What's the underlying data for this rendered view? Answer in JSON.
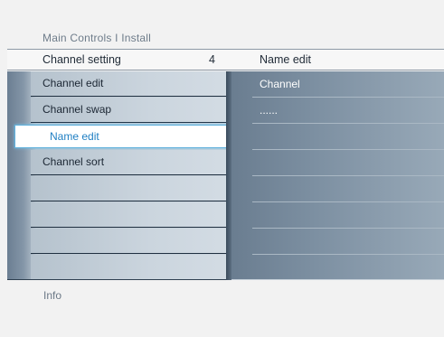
{
  "breadcrumb": "Main Controls I Install",
  "header": {
    "title": "Channel setting",
    "count": "4",
    "right_title": "Name edit"
  },
  "menu": {
    "items": [
      {
        "label": "Channel edit",
        "selected": false
      },
      {
        "label": "Channel swap",
        "selected": false
      },
      {
        "label": "Name edit",
        "selected": true
      },
      {
        "label": "Channel sort",
        "selected": false
      },
      {
        "label": "",
        "selected": false
      },
      {
        "label": "",
        "selected": false
      },
      {
        "label": "",
        "selected": false
      },
      {
        "label": "",
        "selected": false
      }
    ]
  },
  "detail": {
    "rows": [
      "Channel",
      "......",
      "",
      "",
      "",
      "",
      "",
      ""
    ]
  },
  "footer": {
    "info": "Info"
  },
  "colors": {
    "selected_text": "#1f7fc3",
    "selected_border": "#5fb0dc",
    "panel_dark": "#6b7e92"
  }
}
